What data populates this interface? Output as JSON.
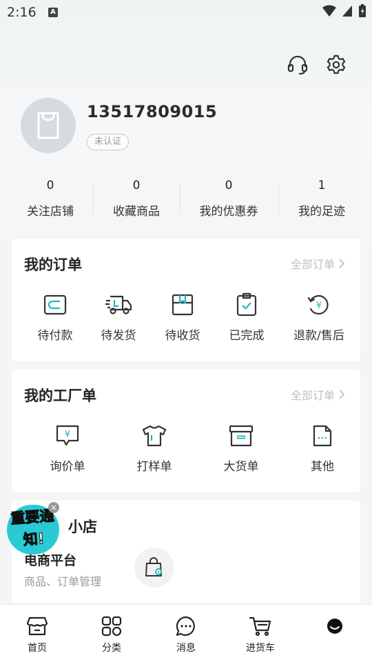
{
  "status_bar": {
    "time": "2:16",
    "notif_letter": "A"
  },
  "profile": {
    "phone": "13517809015",
    "verify_status": "未认证"
  },
  "stats": [
    {
      "num": "0",
      "label": "关注店铺"
    },
    {
      "num": "0",
      "label": "收藏商品"
    },
    {
      "num": "0",
      "label": "我的优惠券"
    },
    {
      "num": "1",
      "label": "我的足迹"
    }
  ],
  "orders": {
    "title": "我的订单",
    "more": "全部订单",
    "items": [
      {
        "label": "待付款",
        "icon": "wallet-icon"
      },
      {
        "label": "待发货",
        "icon": "truck-icon"
      },
      {
        "label": "待收货",
        "icon": "package-icon"
      },
      {
        "label": "已完成",
        "icon": "clipboard-check-icon"
      },
      {
        "label": "退款/售后",
        "icon": "refund-icon"
      }
    ]
  },
  "factory": {
    "title": "我的工厂单",
    "more": "全部订单",
    "items": [
      {
        "label": "询价单",
        "icon": "yen-chat-icon"
      },
      {
        "label": "打样单",
        "icon": "shirt-icon"
      },
      {
        "label": "大货单",
        "icon": "box-icon"
      },
      {
        "label": "其他",
        "icon": "document-icon"
      }
    ]
  },
  "shop": {
    "title": "小店",
    "subtitle": "电商平台",
    "desc": "商品、订单管理"
  },
  "notice": {
    "text": "重要通知!"
  },
  "tabbar": [
    {
      "label": "首页",
      "icon": "store-icon"
    },
    {
      "label": "分类",
      "icon": "category-icon"
    },
    {
      "label": "消息",
      "icon": "message-icon"
    },
    {
      "label": "进货车",
      "icon": "cart-icon"
    },
    {
      "label": "",
      "icon": "profile-icon"
    }
  ],
  "colors": {
    "accent": "#29c9d6",
    "icon_teal": "#20b7c4",
    "text": "#222222",
    "muted": "#999999"
  }
}
